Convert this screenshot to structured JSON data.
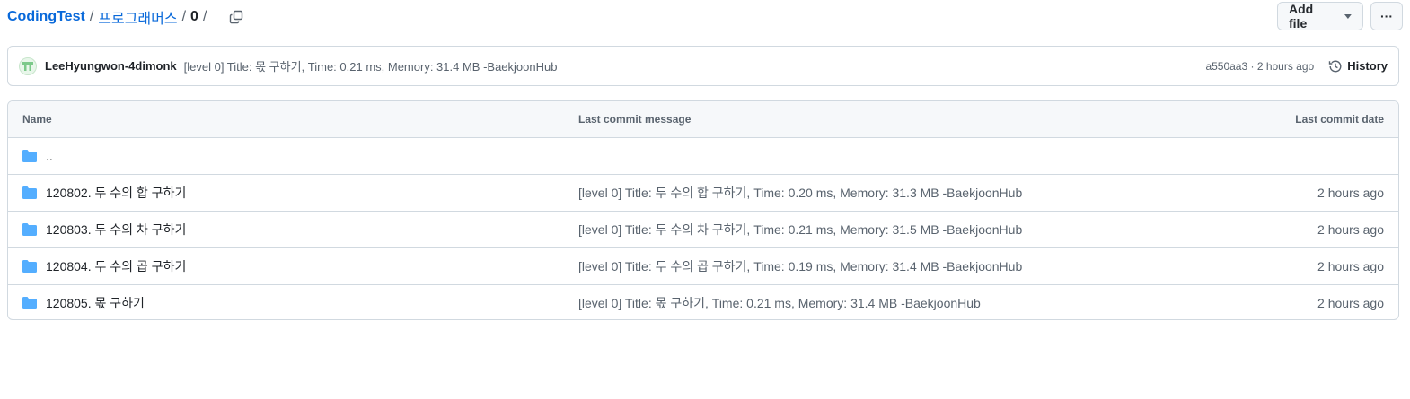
{
  "breadcrumb": {
    "repo": "CodingTest",
    "sep1": "/",
    "folder": "프로그래머스",
    "sep2": "/",
    "current": "0",
    "sep3": "/"
  },
  "toolbar": {
    "add_file_label": "Add file",
    "more_label": "···"
  },
  "latest_commit": {
    "author": "LeeHyungwon-4dimonk",
    "message": "[level 0] Title: 몫 구하기, Time: 0.21 ms, Memory: 31.4 MB -BaekjoonHub",
    "meta": "a550aa3 · 2 hours ago",
    "history_label": "History"
  },
  "table": {
    "headers": {
      "name": "Name",
      "message": "Last commit message",
      "date": "Last commit date"
    },
    "parent_label": "..",
    "rows": [
      {
        "name": "120802. 두 수의 합 구하기",
        "message": "[level 0] Title: 두 수의 합 구하기, Time: 0.20 ms, Memory: 31.3 MB -BaekjoonHub",
        "date": "2 hours ago"
      },
      {
        "name": "120803. 두 수의 차 구하기",
        "message": "[level 0] Title: 두 수의 차 구하기, Time: 0.21 ms, Memory: 31.5 MB -BaekjoonHub",
        "date": "2 hours ago"
      },
      {
        "name": "120804. 두 수의 곱 구하기",
        "message": "[level 0] Title: 두 수의 곱 구하기, Time: 0.19 ms, Memory: 31.4 MB -BaekjoonHub",
        "date": "2 hours ago"
      },
      {
        "name": "120805. 몫 구하기",
        "message": "[level 0] Title: 몫 구하기, Time: 0.21 ms, Memory: 31.4 MB -BaekjoonHub",
        "date": "2 hours ago"
      }
    ]
  },
  "colors": {
    "link": "#0969da",
    "folder_icon": "#54aeff",
    "muted_text": "#59636e",
    "border": "#d1d9e0",
    "header_bg": "#f6f8fa"
  },
  "icons": {
    "copy": "copy-icon",
    "caret": "triangle-down-icon",
    "history": "history-icon",
    "folder": "folder-icon",
    "avatar": "avatar-identicon"
  }
}
